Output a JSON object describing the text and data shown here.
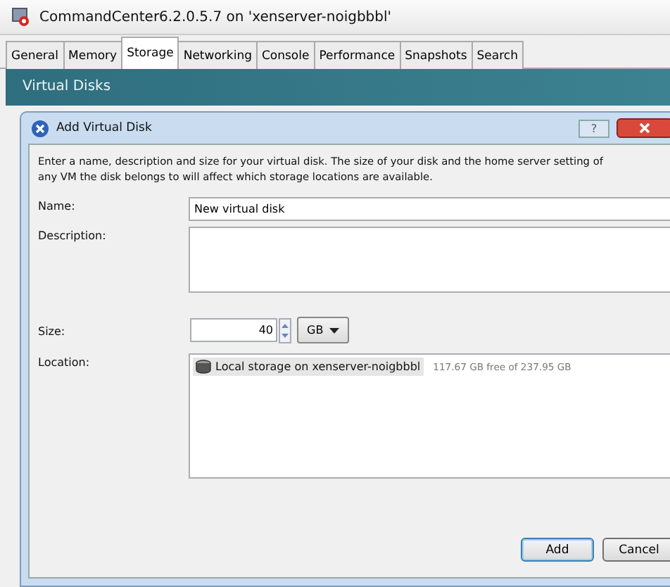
{
  "window": {
    "title": "CommandCenter6.2.0.5.7 on 'xenserver-noigbbbl'"
  },
  "tabs": [
    {
      "label": "General",
      "selected": false
    },
    {
      "label": "Memory",
      "selected": false
    },
    {
      "label": "Storage",
      "selected": true
    },
    {
      "label": "Networking",
      "selected": false
    },
    {
      "label": "Console",
      "selected": false
    },
    {
      "label": "Performance",
      "selected": false
    },
    {
      "label": "Snapshots",
      "selected": false
    },
    {
      "label": "Search",
      "selected": false
    }
  ],
  "section_header": "Virtual Disks",
  "dialog": {
    "title": "Add Virtual Disk",
    "help_button": "?",
    "intro": "Enter a name, description and size for your virtual disk. The size of your disk and the home server setting of any VM the disk belongs to will affect which storage locations are available.",
    "name": {
      "label": "Name:",
      "value": "New virtual disk"
    },
    "description": {
      "label": "Description:"
    },
    "size": {
      "label": "Size:",
      "value": "40",
      "unit": "GB"
    },
    "location": {
      "label": "Location:",
      "items": [
        {
          "name": "Local storage on xenserver-noigbbbl",
          "free": "117.67 GB free of 237.95 GB",
          "selected": true
        }
      ]
    },
    "buttons": [
      {
        "label": "Add",
        "default": true
      },
      {
        "label": "Cancel",
        "default": false
      }
    ]
  }
}
